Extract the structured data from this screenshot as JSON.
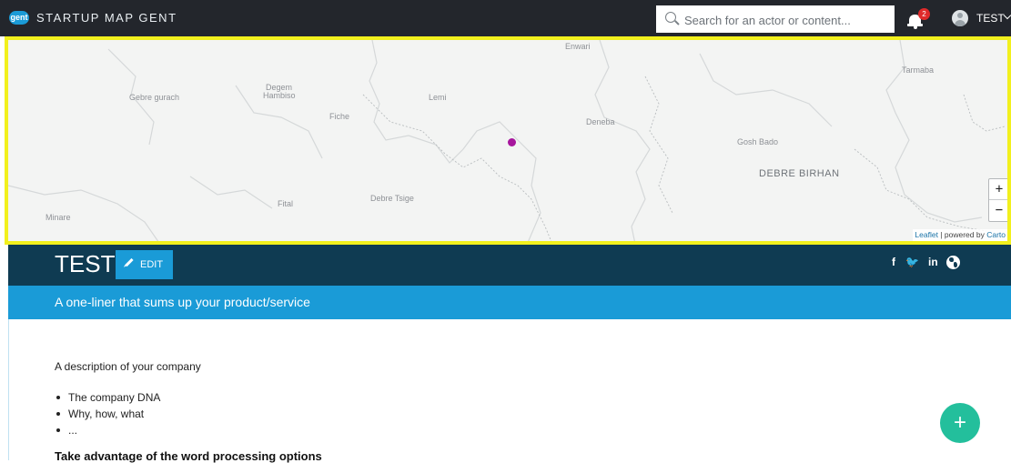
{
  "app": {
    "logo_text": "gent",
    "title": "STARTUP MAP GENT"
  },
  "search": {
    "placeholder": "Search for an actor or content...",
    "icon": "search-icon"
  },
  "notifications": {
    "icon": "bell-icon",
    "count": "2"
  },
  "user": {
    "name": "TEST",
    "icon": "avatar-icon"
  },
  "map": {
    "places": [
      "Enwari",
      "Tarmaba",
      "Gebre gurach",
      "Degem",
      "Hambiso",
      "Lemi",
      "Fiche",
      "Deneba",
      "Gosh Bado",
      "DEBRE BIRHAN",
      "Fital",
      "Debre Tsige",
      "Minare"
    ],
    "marker_color": "#a7169d",
    "zoom_in_label": "+",
    "zoom_out_label": "−",
    "attribution": {
      "leaflet": "Leaflet",
      "separator": " | powered by ",
      "provider": "Carto"
    },
    "border_color": "#f2f01d"
  },
  "profile": {
    "title": "TEST",
    "edit_label": "EDIT",
    "social": {
      "facebook": "f",
      "twitter": "🐦",
      "linkedin": "in",
      "website_icon": "globe-icon"
    },
    "tagline": "A one-liner that sums up your product/service"
  },
  "content": {
    "description": "A description of your company",
    "bullets": [
      "The company DNA",
      "Why, how, what",
      "..."
    ],
    "heading": "Take advantage of the word processing options"
  },
  "fab": {
    "label": "+",
    "icon": "plus-icon"
  },
  "colors": {
    "topbar": "#23262c",
    "header": "#0f3b52",
    "accent": "#1a9bd7",
    "fab": "#23bf9c"
  }
}
